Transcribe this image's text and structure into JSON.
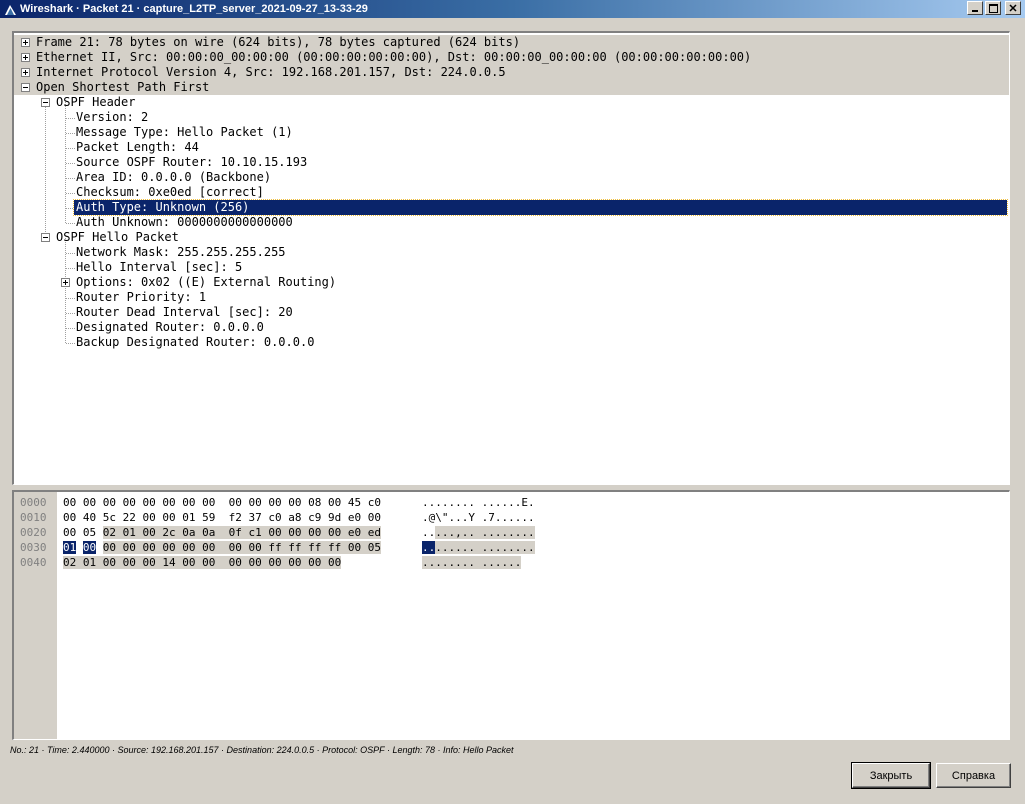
{
  "window": {
    "title": "Wireshark · Packet 21 · capture_L2TP_server_2021-09-27_13-33-29",
    "icon": "wireshark-fin-icon"
  },
  "details": {
    "rows": [
      {
        "text": "Frame 21: 78 bytes on wire (624 bits), 78 bytes captured (624 bits)",
        "expander": "plus"
      },
      {
        "text": "Ethernet II, Src: 00:00:00_00:00:00 (00:00:00:00:00:00), Dst: 00:00:00_00:00:00 (00:00:00:00:00:00)",
        "expander": "plus"
      },
      {
        "text": "Internet Protocol Version 4, Src: 192.168.201.157, Dst: 224.0.0.5",
        "expander": "plus"
      },
      {
        "text": "Open Shortest Path First",
        "expander": "minus"
      },
      {
        "text": "OSPF Header",
        "expander": "minus"
      },
      {
        "text": "Version: 2"
      },
      {
        "text": "Message Type: Hello Packet (1)"
      },
      {
        "text": "Packet Length: 44"
      },
      {
        "text": "Source OSPF Router: 10.10.15.193"
      },
      {
        "text": "Area ID: 0.0.0.0 (Backbone)"
      },
      {
        "text": "Checksum: 0xe0ed [correct]"
      },
      {
        "text": "Auth Type: Unknown (256)",
        "selected": true
      },
      {
        "text": "Auth Unknown: 0000000000000000"
      },
      {
        "text": "OSPF Hello Packet",
        "expander": "minus"
      },
      {
        "text": "Network Mask: 255.255.255.255"
      },
      {
        "text": "Hello Interval [sec]: 5"
      },
      {
        "text": "Options: 0x02 ((E) External Routing)",
        "expander": "plus"
      },
      {
        "text": "Router Priority: 1"
      },
      {
        "text": "Router Dead Interval [sec]: 20"
      },
      {
        "text": "Designated Router: 0.0.0.0"
      },
      {
        "text": "Backup Designated Router: 0.0.0.0"
      }
    ]
  },
  "hex": {
    "lines": [
      {
        "offset": "0000",
        "a": "00 00 00 00 00 00 00 00",
        "b": "00 00 00 00 08 00 45 c0",
        "ascii_a": "........",
        "ascii_b": "......E."
      },
      {
        "offset": "0010",
        "a": "00 40 5c 22 00 00 01 59",
        "b": "f2 37 c0 a8 c9 9d e0 00",
        "ascii_a": ".@\\\"...Y",
        "ascii_b": ".7......"
      },
      {
        "offset": "0020",
        "a": "00 05 02 01 00 2c 0a 0a",
        "b": "0f c1 00 00 00 00 e0 ed",
        "ascii_a": ".....,..",
        "ascii_b": "........"
      },
      {
        "offset": "0030",
        "a": "01 00 00 00 00 00 00 00",
        "b": "00 00 ff ff ff ff 00 05",
        "ascii_a": "........",
        "ascii_b": "........"
      },
      {
        "offset": "0040",
        "a": "02 01 00 00 00 14 00 00",
        "b": "00 00 00 00 00 00",
        "ascii_a": "........",
        "ascii_b": "......"
      }
    ]
  },
  "status": {
    "text": "No.: 21 · Time: 2.440000 · Source: 192.168.201.157 · Destination: 224.0.0.5 · Protocol: OSPF · Length: 78 · Info: Hello Packet"
  },
  "buttons": {
    "close_label": "Закрыть",
    "help_label": "Справка"
  }
}
